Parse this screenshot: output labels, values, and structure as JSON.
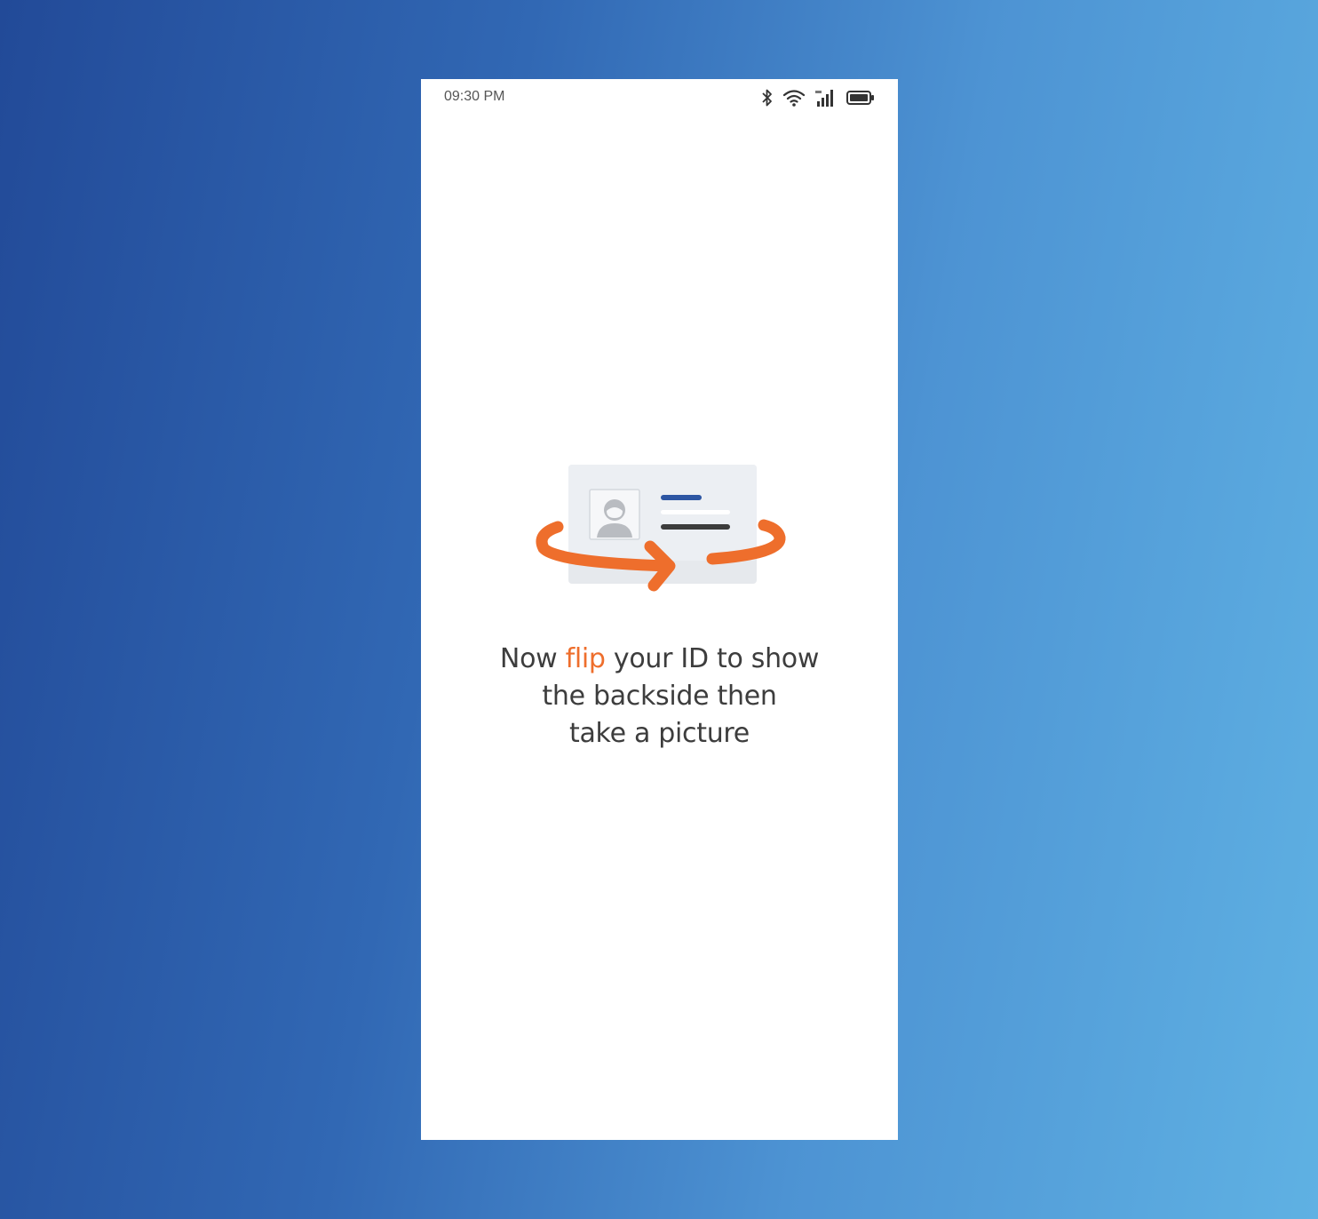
{
  "status_bar": {
    "time": "09:30 PM",
    "icons": [
      "bluetooth-icon",
      "wifi-icon",
      "signal-icon",
      "battery-icon"
    ]
  },
  "illustration": {
    "name": "id-card-flip-illustration",
    "colors": {
      "arrow": "#ee6e2c",
      "card": "#eceff3",
      "accent_line": "#2d56a3",
      "dark_line": "#3c3c3c"
    }
  },
  "instruction": {
    "line1_prefix": "Now ",
    "line1_highlight": "flip",
    "line1_suffix": " your ID to show",
    "line2": "the backside then",
    "line3": "take a picture",
    "highlight_color": "#ee6e2c"
  },
  "colors": {
    "background_start": "#224a98",
    "background_end": "#5fb1e3",
    "screen": "#ffffff"
  }
}
